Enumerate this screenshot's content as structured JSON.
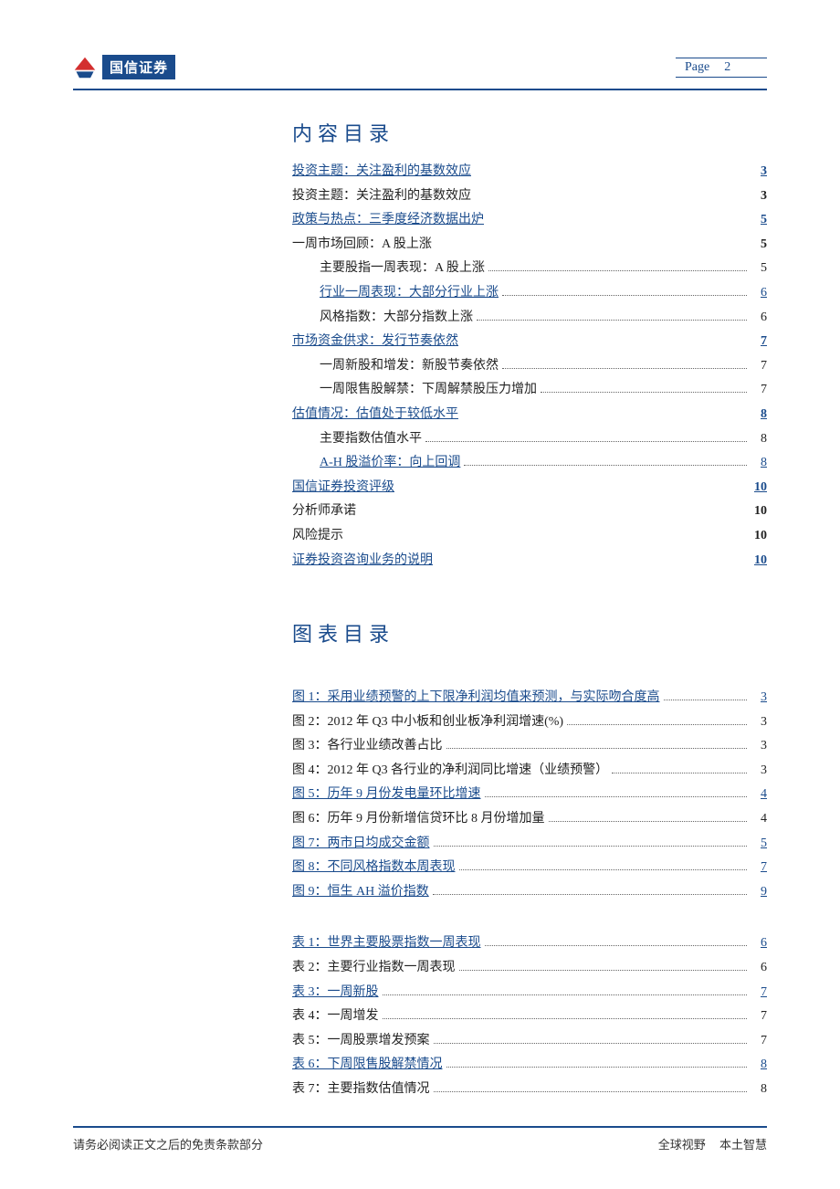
{
  "header": {
    "logo_text": "国信证券",
    "page_label": "Page",
    "page_number": "2"
  },
  "toc_title": "内容目录",
  "toc": [
    {
      "label": "投资主题：关注盈利的基数效应",
      "page": "3",
      "link": true,
      "bold": true,
      "indent": 0,
      "fill": false
    },
    {
      "label": "投资主题：关注盈利的基数效应",
      "page": "3",
      "link": false,
      "bold": true,
      "indent": 0,
      "fill": false
    },
    {
      "label": "政策与热点：三季度经济数据出炉",
      "page": "5",
      "link": true,
      "bold": true,
      "indent": 0,
      "fill": false
    },
    {
      "label": "一周市场回顾：A 股上涨",
      "page": "5",
      "link": false,
      "bold": true,
      "indent": 0,
      "fill": false
    },
    {
      "label": "主要股指一周表现：A 股上涨",
      "page": "5",
      "link": false,
      "bold": false,
      "indent": 1,
      "fill": true
    },
    {
      "label": "行业一周表现：大部分行业上涨",
      "page": "6",
      "link": true,
      "bold": false,
      "indent": 1,
      "fill": true
    },
    {
      "label": "风格指数：大部分指数上涨",
      "page": "6",
      "link": false,
      "bold": false,
      "indent": 1,
      "fill": true
    },
    {
      "label": "市场资金供求：发行节奏依然",
      "page": "7",
      "link": true,
      "bold": true,
      "indent": 0,
      "fill": false
    },
    {
      "label": "一周新股和增发：新股节奏依然",
      "page": "7",
      "link": false,
      "bold": false,
      "indent": 1,
      "fill": true
    },
    {
      "label": "一周限售股解禁：下周解禁股压力增加",
      "page": "7",
      "link": false,
      "bold": false,
      "indent": 1,
      "fill": true
    },
    {
      "label": "估值情况：估值处于较低水平",
      "page": "8",
      "link": true,
      "bold": true,
      "indent": 0,
      "fill": false
    },
    {
      "label": "主要指数估值水平",
      "page": "8",
      "link": false,
      "bold": false,
      "indent": 1,
      "fill": true
    },
    {
      "label": "A-H 股溢价率：向上回调",
      "page": "8",
      "link": true,
      "bold": false,
      "indent": 1,
      "fill": true
    },
    {
      "label": "国信证券投资评级",
      "page": "10",
      "link": true,
      "bold": true,
      "indent": 0,
      "fill": false
    },
    {
      "label": "分析师承诺",
      "page": "10",
      "link": false,
      "bold": true,
      "indent": 0,
      "fill": false
    },
    {
      "label": "风险提示",
      "page": "10",
      "link": false,
      "bold": true,
      "indent": 0,
      "fill": false
    },
    {
      "label": "证券投资咨询业务的说明",
      "page": "10",
      "link": true,
      "bold": true,
      "indent": 0,
      "fill": false
    }
  ],
  "figures_title": "图表目录",
  "figures": [
    {
      "label": "图 1：采用业绩预警的上下限净利润均值来预测，与实际吻合度高",
      "page": "3",
      "link": true
    },
    {
      "label": "图 2：2012 年 Q3 中小板和创业板净利润增速(%)",
      "page": "3",
      "link": false
    },
    {
      "label": "图 3：各行业业绩改善占比",
      "page": "3",
      "link": false
    },
    {
      "label": "图 4：2012 年 Q3 各行业的净利润同比增速（业绩预警）",
      "page": "3",
      "link": false
    },
    {
      "label": "图 5：历年 9 月份发电量环比增速",
      "page": "4",
      "link": true
    },
    {
      "label": "图 6：历年 9 月份新增信贷环比 8 月份增加量",
      "page": "4",
      "link": false
    },
    {
      "label": "图 7：两市日均成交金额",
      "page": "5",
      "link": true
    },
    {
      "label": "图 8：不同风格指数本周表现",
      "page": "7",
      "link": true
    },
    {
      "label": "图 9：恒生 AH 溢价指数",
      "page": "9",
      "link": true
    }
  ],
  "tables": [
    {
      "label": "表 1：世界主要股票指数一周表现",
      "page": "6",
      "link": true
    },
    {
      "label": "表 2：主要行业指数一周表现",
      "page": "6",
      "link": false
    },
    {
      "label": "表 3：一周新股",
      "page": "7",
      "link": true
    },
    {
      "label": "表 4：一周增发",
      "page": "7",
      "link": false
    },
    {
      "label": "表 5：一周股票增发预案",
      "page": "7",
      "link": false
    },
    {
      "label": "表 6：下周限售股解禁情况",
      "page": "8",
      "link": true
    },
    {
      "label": "表 7：主要指数估值情况",
      "page": "8",
      "link": false
    }
  ],
  "footer": {
    "left": "请务必阅读正文之后的免责条款部分",
    "right1": "全球视野",
    "right2": "本土智慧"
  }
}
